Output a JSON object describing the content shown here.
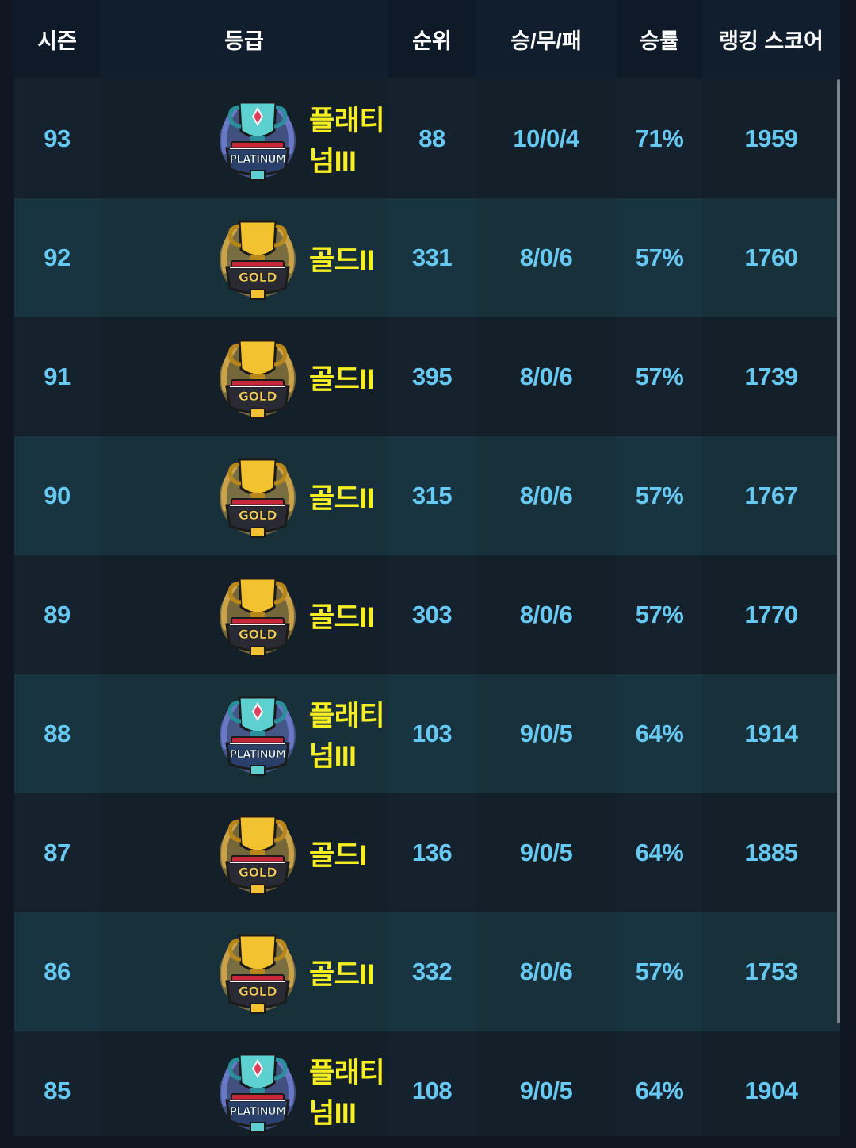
{
  "columns": {
    "season": "시즌",
    "grade": "등급",
    "rank": "순위",
    "wdl": "승/무/패",
    "winrate": "승률",
    "score": "랭킹 스코어"
  },
  "badge_text": {
    "platinum": "PLATINUM",
    "gold": "GOLD"
  },
  "colors": {
    "value_text": "#67c8f2",
    "tier_text": "#f6ee22",
    "header_text": "#ffffff"
  },
  "rows": [
    {
      "season": "93",
      "badge": "platinum",
      "tier": "플래티넘III",
      "rank": "88",
      "wdl": "10/0/4",
      "winrate": "71%",
      "score": "1959"
    },
    {
      "season": "92",
      "badge": "gold",
      "tier": "골드II",
      "rank": "331",
      "wdl": "8/0/6",
      "winrate": "57%",
      "score": "1760"
    },
    {
      "season": "91",
      "badge": "gold",
      "tier": "골드II",
      "rank": "395",
      "wdl": "8/0/6",
      "winrate": "57%",
      "score": "1739"
    },
    {
      "season": "90",
      "badge": "gold",
      "tier": "골드II",
      "rank": "315",
      "wdl": "8/0/6",
      "winrate": "57%",
      "score": "1767"
    },
    {
      "season": "89",
      "badge": "gold",
      "tier": "골드II",
      "rank": "303",
      "wdl": "8/0/6",
      "winrate": "57%",
      "score": "1770"
    },
    {
      "season": "88",
      "badge": "platinum",
      "tier": "플래티넘III",
      "rank": "103",
      "wdl": "9/0/5",
      "winrate": "64%",
      "score": "1914"
    },
    {
      "season": "87",
      "badge": "gold",
      "tier": "골드I",
      "rank": "136",
      "wdl": "9/0/5",
      "winrate": "64%",
      "score": "1885"
    },
    {
      "season": "86",
      "badge": "gold",
      "tier": "골드II",
      "rank": "332",
      "wdl": "8/0/6",
      "winrate": "57%",
      "score": "1753"
    },
    {
      "season": "85",
      "badge": "platinum",
      "tier": "플래티넘III",
      "rank": "108",
      "wdl": "9/0/5",
      "winrate": "64%",
      "score": "1904"
    }
  ]
}
